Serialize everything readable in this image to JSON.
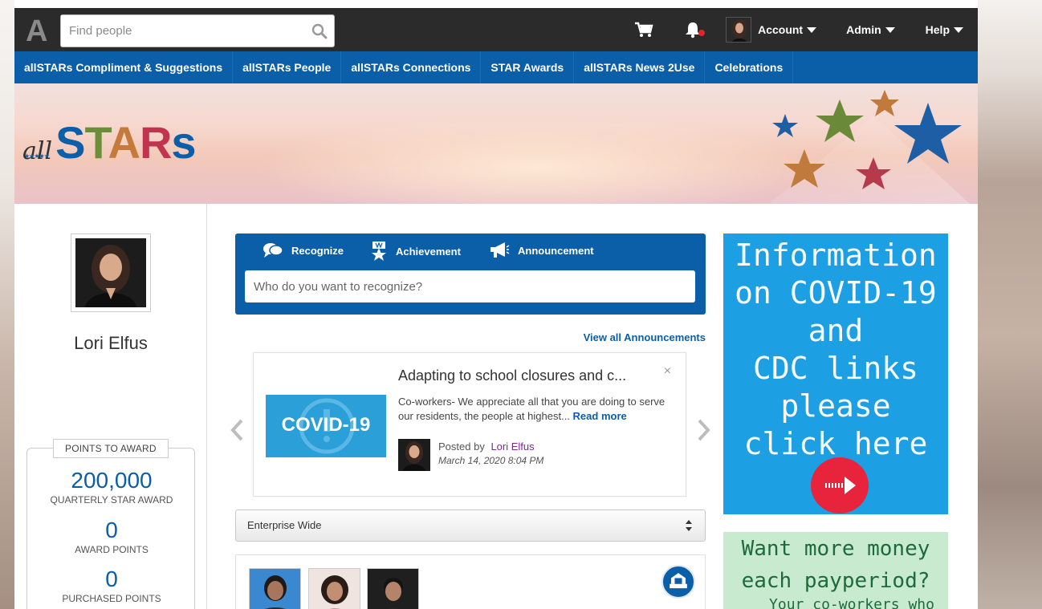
{
  "header": {
    "logo_letter": "A",
    "search_placeholder": "Find people",
    "account_label": "Account",
    "admin_label": "Admin",
    "help_label": "Help"
  },
  "nav": {
    "items": [
      "allSTARs Compliment & Suggestions",
      "allSTARs People",
      "allSTARs Connections",
      "STAR Awards",
      "allSTARs News 2Use",
      "Celebrations"
    ]
  },
  "banner": {
    "brand_all": "all",
    "brand_letters": [
      "S",
      "T",
      "A",
      "R",
      "s"
    ],
    "brand_colors": [
      "#0b5ea8",
      "#6b8e3a",
      "#c47a3a",
      "#c0354d",
      "#0b5ea8"
    ]
  },
  "profile": {
    "name": "Lori Elfus",
    "points_title": "POINTS TO AWARD",
    "points": [
      {
        "value": "200,000",
        "label": "QUARTERLY STAR AWARD"
      },
      {
        "value": "0",
        "label": "AWARD POINTS"
      },
      {
        "value": "0",
        "label": "PURCHASED POINTS"
      }
    ]
  },
  "composer": {
    "tabs": [
      "Recognize",
      "Achievement",
      "Announcement"
    ],
    "placeholder": "Who do you want to recognize?"
  },
  "announcements": {
    "view_all": "View all Announcements",
    "card": {
      "image_text": "COVID-19",
      "title": "Adapting to school closures and c...",
      "body": "Co-workers- We appreciate all that you are doing to serve our residents, the people at highest...",
      "read_more": "Read more",
      "posted_by_label": "Posted by",
      "author": "Lori Elfus",
      "date": "March 14, 2020 8:04 PM"
    }
  },
  "scope": {
    "selected": "Enterprise Wide"
  },
  "sidebar_right": {
    "covid_lines": [
      "Information",
      "on COVID-19",
      "and",
      "CDC links",
      "please",
      "click here"
    ],
    "money_line1": "Want more money",
    "money_line2": "each payperiod?",
    "money_line3": "Your co-workers who"
  },
  "colors": {
    "brand_blue": "#0b5ea8",
    "topbar": "#2b2b2b",
    "covid_bg": "#1c9fe3",
    "money_bg": "#c8ebd0"
  }
}
